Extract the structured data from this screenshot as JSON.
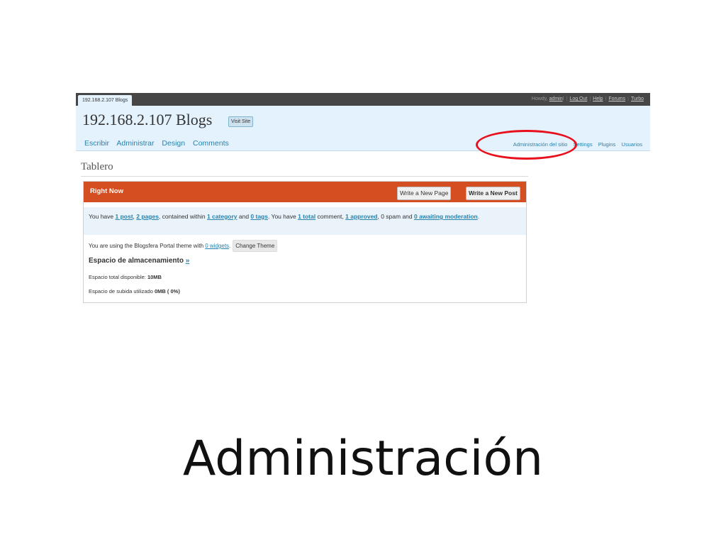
{
  "top_bar": {
    "site_tab": "192.168.2.107 Blogs",
    "howdy": "Howdy,",
    "user": "admin",
    "howdy_end": "!",
    "links": [
      "Log Out",
      "Help",
      "Forums",
      "Turbo"
    ]
  },
  "header": {
    "blog_title": "192.168.2.107 Blogs",
    "visit_site": "Visit Site",
    "main_nav": [
      "Escribir",
      "Administrar",
      "Design",
      "Comments"
    ],
    "side_nav": [
      "Administración del sitio",
      "Settings",
      "Plugins",
      "Usuarios"
    ]
  },
  "page": {
    "title": "Tablero"
  },
  "right_now": {
    "title": "Right Now",
    "write_page": "Write a New Page",
    "write_post": "Write a New Post",
    "counts": {
      "t1": "You have ",
      "posts": "1 post",
      "t2": ", ",
      "pages": "2 pages",
      "t3": ", contained within ",
      "categories": "1 category",
      "t4": " and ",
      "tags": "0 tags",
      "t5": ". You have ",
      "total": "1 total",
      "t6": " comment, ",
      "approved": "1 approved",
      "t7": ", 0 spam and ",
      "awaiting": "0 awaiting moderation",
      "t8": "."
    },
    "theme": {
      "t1": "You are using the Blogsfera Portal theme with ",
      "widgets": "0 widgets",
      "t2": ".",
      "change": "Change Theme"
    },
    "storage": {
      "heading": "Espacio de almacenamiento ",
      "more": "»",
      "total_label": "Espacio total disponible: ",
      "total_value": "10MB",
      "used_label": "Espacio de subida utilizado ",
      "used_value": "0MB ( 0%)"
    }
  },
  "slide": {
    "title": "Administración"
  },
  "colors": {
    "header_bg": "#e4f2fd",
    "top_bar": "#464646",
    "box_head": "#d54e21",
    "link": "#2583ad",
    "highlight": "#e8101c"
  }
}
